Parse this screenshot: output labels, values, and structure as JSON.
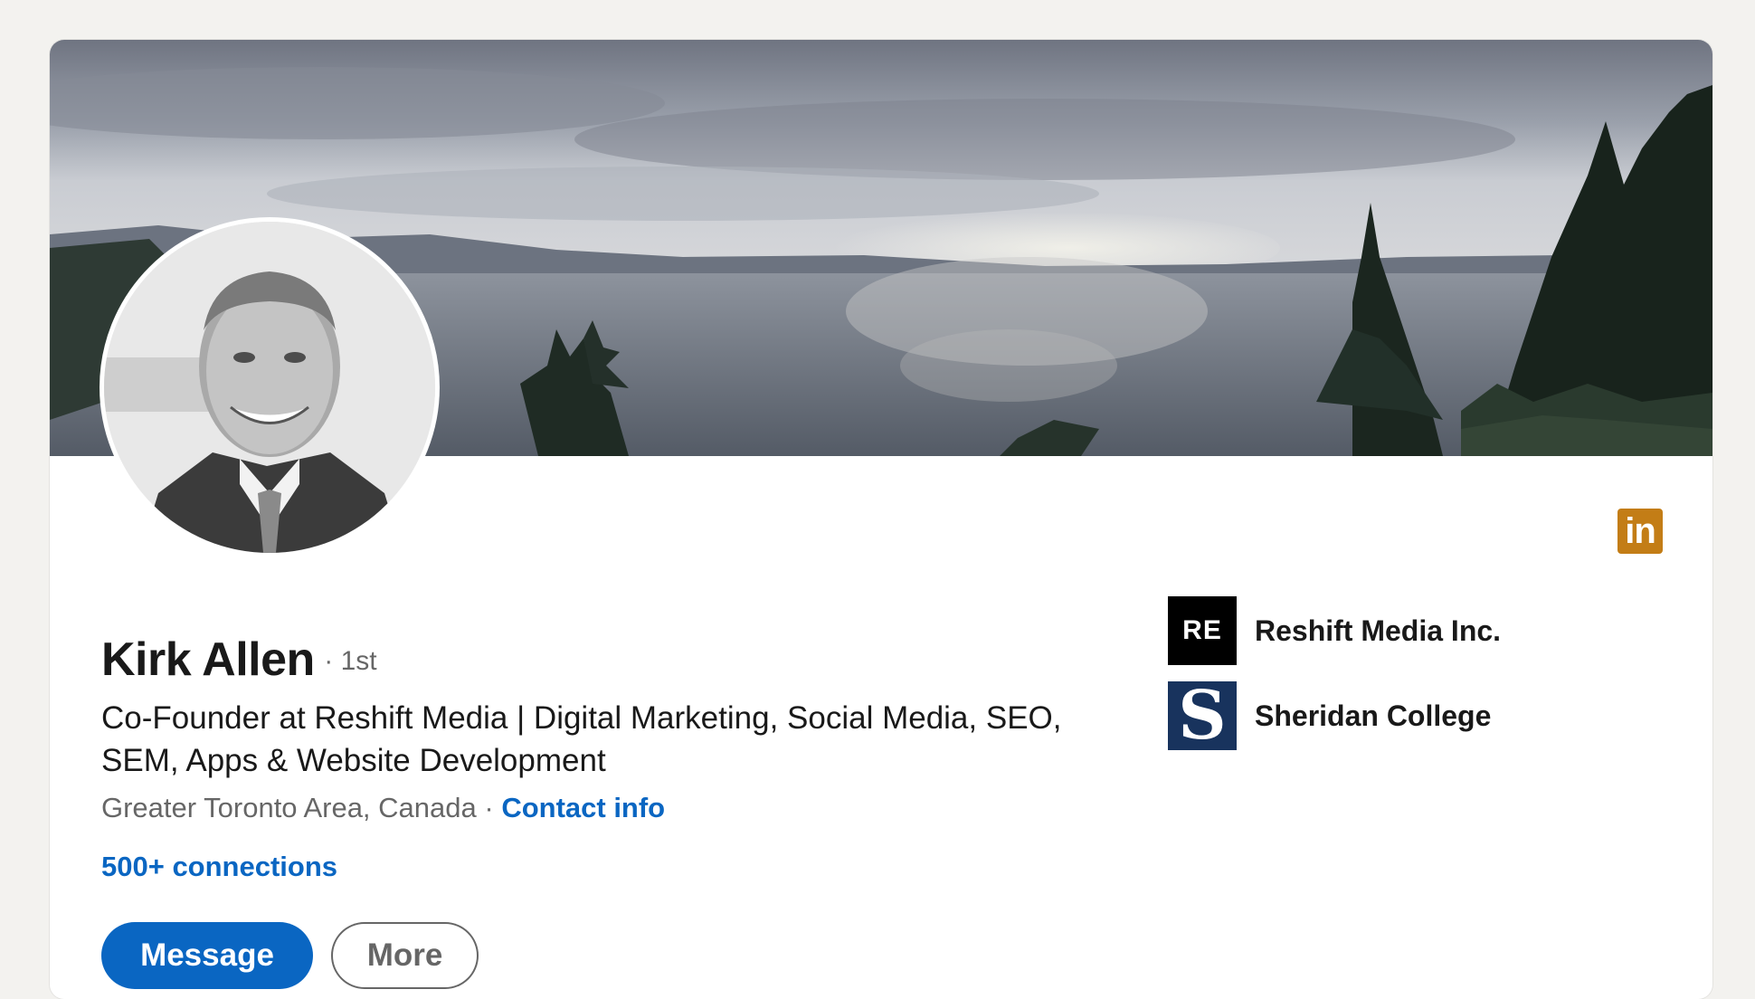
{
  "profile": {
    "name": "Kirk Allen",
    "degree": "· 1st",
    "headline": "Co-Founder at Reshift Media | Digital Marketing, Social Media, SEO, SEM, Apps & Website Development",
    "location": "Greater Toronto Area, Canada",
    "location_separator": " · ",
    "contact_info_label": "Contact info",
    "connections": "500+ connections"
  },
  "actions": {
    "message_label": "Message",
    "more_label": "More"
  },
  "organizations": [
    {
      "logo_text": "RE",
      "name": "Reshift Media Inc.",
      "logo_color": "#000000"
    },
    {
      "logo_text": "S",
      "name": "Sheridan College",
      "logo_color": "#18335d"
    }
  ],
  "badge": {
    "icon": "linkedin-icon",
    "text": "in",
    "color": "#c37d16"
  },
  "colors": {
    "primary": "#0a66c2",
    "page_background": "#f3f2ef"
  }
}
